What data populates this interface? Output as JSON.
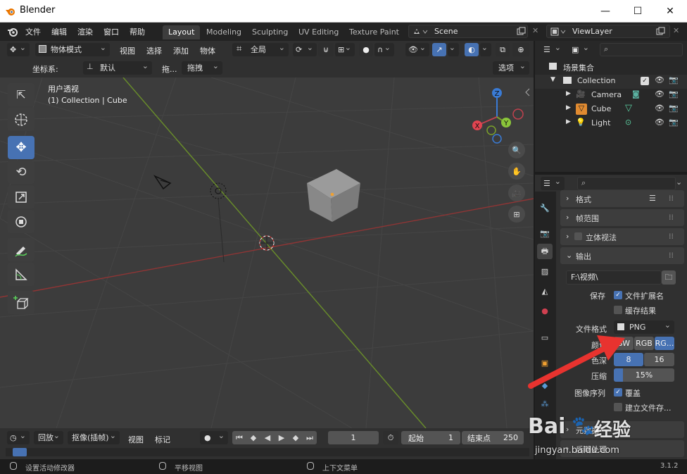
{
  "window": {
    "title": "Blender",
    "minimize": "—",
    "maximize": "☐",
    "close": "✕"
  },
  "menu": [
    "文件",
    "编辑",
    "渲染",
    "窗口",
    "帮助"
  ],
  "workspaces": [
    "Layout",
    "Modeling",
    "Sculpting",
    "UV Editing",
    "Texture Paint"
  ],
  "scene": {
    "name": "Scene",
    "view_layer": "ViewLayer"
  },
  "viewport_header": {
    "mode": "物体模式",
    "menus": [
      "视图",
      "选择",
      "添加",
      "物体"
    ],
    "transform_orientation": "全局"
  },
  "viewport_header2": {
    "coord_label": "坐标系:",
    "coord_value": "默认",
    "drag_label": "拖...",
    "drag_value": "拖拽",
    "options": "选项"
  },
  "viewport": {
    "view_name": "用户透视",
    "collection_info": "(1) Collection | Cube"
  },
  "gizmo": {
    "x": "X",
    "y": "Y",
    "z": "Z"
  },
  "outliner": {
    "scene_collection": "场景集合",
    "collection": "Collection",
    "items": [
      "Camera",
      "Cube",
      "Light"
    ]
  },
  "properties": {
    "sections": {
      "format": "格式",
      "frame_range": "帧范围",
      "stereoscopy": "立体视法",
      "output": "输出"
    },
    "output_path": "F:\\视频\\",
    "save_label": "保存",
    "file_ext": "文件扩展名",
    "cache_result": "缓存结果",
    "file_format_label": "文件格式",
    "file_format": "PNG",
    "color_label": "颜色",
    "color_opts": [
      "BW",
      "RGB",
      "RG..."
    ],
    "depth_label": "色深",
    "depth_opts": [
      "8",
      "16"
    ],
    "compress_label": "压缩",
    "compress_value": "15%",
    "seq_label": "图像序列",
    "overwrite": "覆盖",
    "placeholders": "建立文件存...",
    "metadata": "元数据",
    "post_processing": "后期处理"
  },
  "timeline": {
    "playback": "回放",
    "keying": "抠像(插帧)",
    "view": "视图",
    "marker": "标记",
    "current_frame": "1",
    "start_label": "起始",
    "start": "1",
    "end_label": "结束点",
    "end": "250"
  },
  "status": {
    "left": "设置活动修改器",
    "middle": "平移视图",
    "right": "上下文菜单",
    "version": "3.1.2"
  },
  "watermark": {
    "brand": "Bai",
    "brand2": "经验",
    "url": "jingyan.baidu.com"
  },
  "colors": {
    "accent": "#4772b3",
    "x_axis": "#c04a4a",
    "y_axis": "#7aa02a",
    "arrow": "#e8332f"
  }
}
